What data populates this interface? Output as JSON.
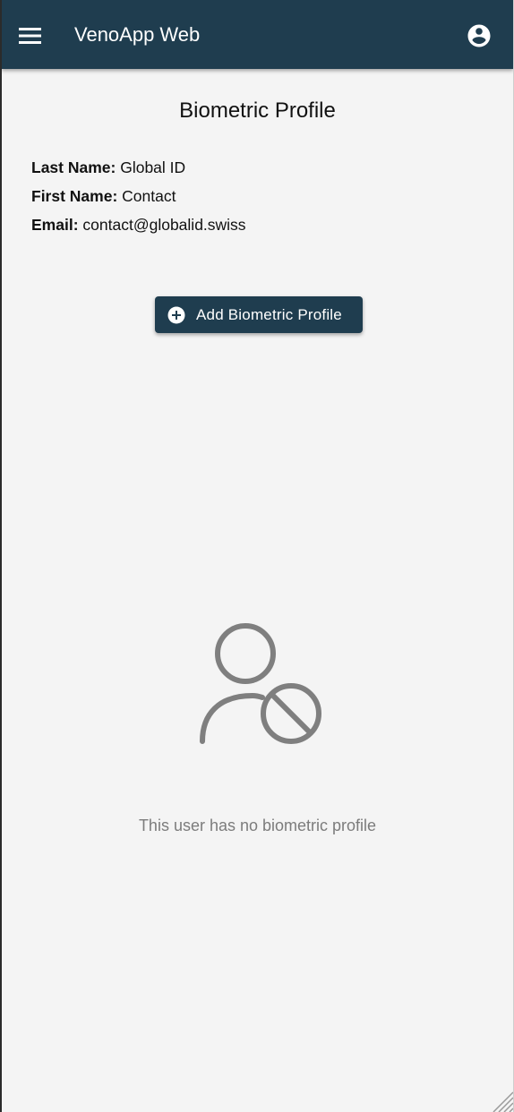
{
  "appbar": {
    "title": "VenoApp Web",
    "menu_icon": "menu-icon",
    "account_icon": "account-circle-icon",
    "color": "#1f3d4f"
  },
  "page": {
    "title": "Biometric Profile"
  },
  "user_info": {
    "last_name_label": "Last Name:",
    "last_name_value": "Global ID",
    "first_name_label": "First Name:",
    "first_name_value": "Contact",
    "email_label": "Email:",
    "email_value": "contact@globalid.swiss"
  },
  "actions": {
    "add_biometric_profile_label": "Add Biometric Profile",
    "add_icon": "add-circle-icon"
  },
  "empty_state": {
    "icon": "user-blocked-icon",
    "message": "This user has no biometric profile",
    "text_color": "#7c7c7c"
  }
}
